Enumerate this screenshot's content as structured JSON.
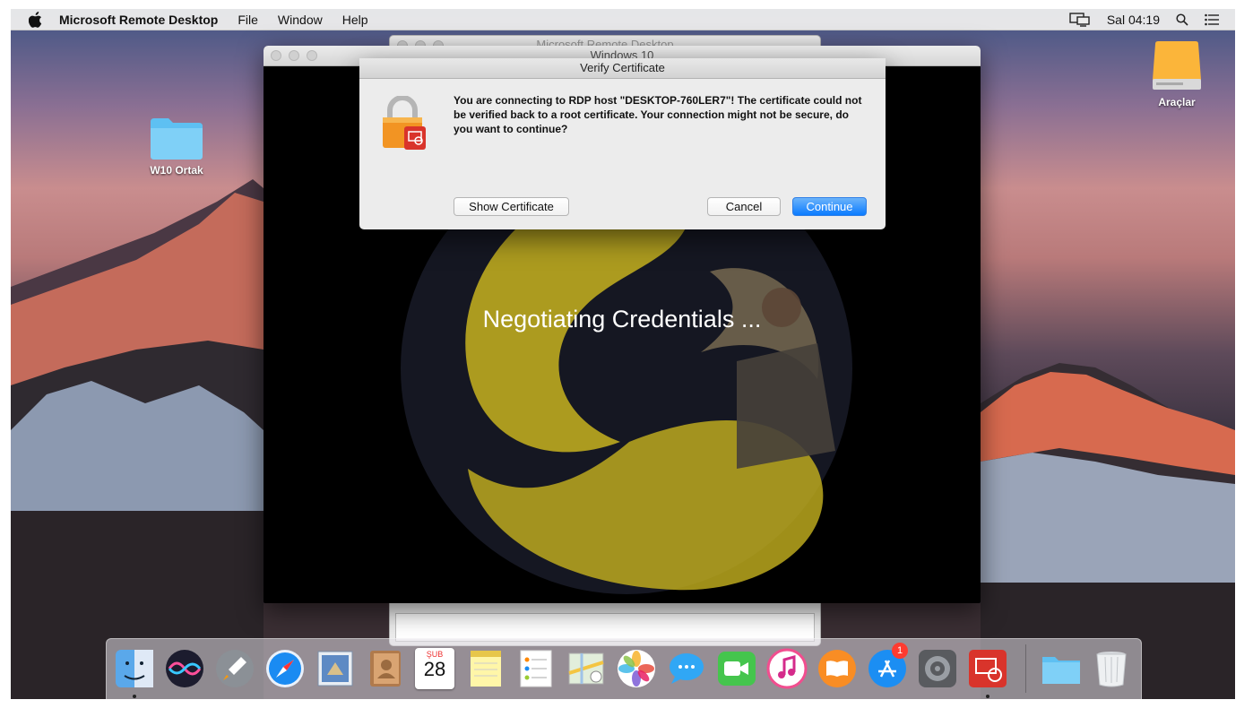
{
  "menubar": {
    "app_name": "Microsoft Remote Desktop",
    "items": [
      "File",
      "Window",
      "Help"
    ],
    "clock": "Sal 04:19",
    "icons": [
      "apple-icon",
      "display-icon",
      "spotlight-icon",
      "notification-center-icon"
    ]
  },
  "desktop": {
    "icons": [
      {
        "label": "W10 Ortak",
        "icon": "folder-icon"
      },
      {
        "label": "Araçlar",
        "icon": "external-drive-icon"
      }
    ]
  },
  "background_window": {
    "title": "Microsoft Remote Desktop"
  },
  "remote_window": {
    "title": "Windows 10",
    "status": "Negotiating Credentials ..."
  },
  "dialog": {
    "title": "Verify Certificate",
    "message": "You are connecting to RDP host \"DESKTOP-760LER7\"! The certificate could not be verified back to a root certificate. Your connection might not be secure, do you want to continue?",
    "show_certificate": "Show Certificate",
    "cancel": "Cancel",
    "continue": "Continue"
  },
  "dock": {
    "apps": [
      "Finder",
      "Siri",
      "Launchpad",
      "Safari",
      "Mail",
      "Contacts",
      "Calendar",
      "Notes",
      "Reminders",
      "Maps",
      "Photos",
      "Messages",
      "FaceTime",
      "iTunes",
      "iBooks",
      "App Store",
      "System Preferences",
      "Microsoft Remote Desktop",
      "Folder",
      "Trash"
    ],
    "calendar_month": "ŞUB",
    "calendar_day": "28",
    "app_store_badge": "1"
  },
  "colors": {
    "accent": "#0a7bff",
    "folder": "#5ec0f2",
    "lock_orange": "#f29423"
  }
}
